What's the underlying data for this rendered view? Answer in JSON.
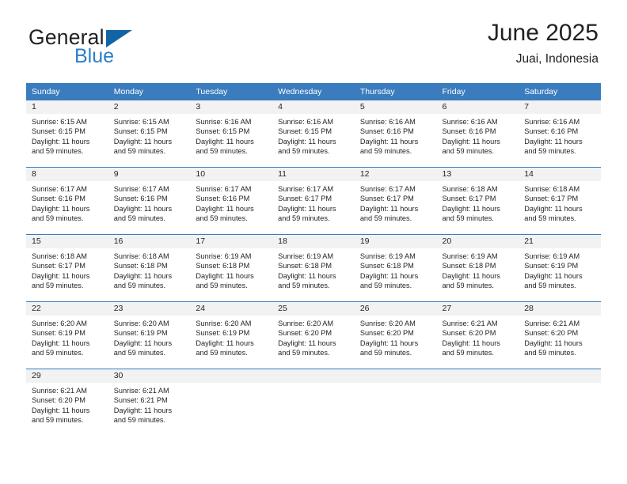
{
  "logo": {
    "word1": "General",
    "word2": "Blue",
    "triangle_color": "#1464a5",
    "blue_color": "#2a7fc9"
  },
  "header": {
    "title": "June 2025",
    "subtitle": "Juai, Indonesia"
  },
  "theme": {
    "header_blue": "#3a7cbe",
    "daynum_bg": "#f2f2f2",
    "text": "#231f20"
  },
  "weekdays": [
    "Sunday",
    "Monday",
    "Tuesday",
    "Wednesday",
    "Thursday",
    "Friday",
    "Saturday"
  ],
  "labels": {
    "sunrise_prefix": "Sunrise: ",
    "sunset_prefix": "Sunset: ",
    "daylight_prefix": "Daylight: "
  },
  "weeks": [
    [
      {
        "day": "1",
        "sunrise": "Sunrise: 6:15 AM",
        "sunset": "Sunset: 6:15 PM",
        "daylight1": "Daylight: 11 hours",
        "daylight2": "and 59 minutes."
      },
      {
        "day": "2",
        "sunrise": "Sunrise: 6:15 AM",
        "sunset": "Sunset: 6:15 PM",
        "daylight1": "Daylight: 11 hours",
        "daylight2": "and 59 minutes."
      },
      {
        "day": "3",
        "sunrise": "Sunrise: 6:16 AM",
        "sunset": "Sunset: 6:15 PM",
        "daylight1": "Daylight: 11 hours",
        "daylight2": "and 59 minutes."
      },
      {
        "day": "4",
        "sunrise": "Sunrise: 6:16 AM",
        "sunset": "Sunset: 6:15 PM",
        "daylight1": "Daylight: 11 hours",
        "daylight2": "and 59 minutes."
      },
      {
        "day": "5",
        "sunrise": "Sunrise: 6:16 AM",
        "sunset": "Sunset: 6:16 PM",
        "daylight1": "Daylight: 11 hours",
        "daylight2": "and 59 minutes."
      },
      {
        "day": "6",
        "sunrise": "Sunrise: 6:16 AM",
        "sunset": "Sunset: 6:16 PM",
        "daylight1": "Daylight: 11 hours",
        "daylight2": "and 59 minutes."
      },
      {
        "day": "7",
        "sunrise": "Sunrise: 6:16 AM",
        "sunset": "Sunset: 6:16 PM",
        "daylight1": "Daylight: 11 hours",
        "daylight2": "and 59 minutes."
      }
    ],
    [
      {
        "day": "8",
        "sunrise": "Sunrise: 6:17 AM",
        "sunset": "Sunset: 6:16 PM",
        "daylight1": "Daylight: 11 hours",
        "daylight2": "and 59 minutes."
      },
      {
        "day": "9",
        "sunrise": "Sunrise: 6:17 AM",
        "sunset": "Sunset: 6:16 PM",
        "daylight1": "Daylight: 11 hours",
        "daylight2": "and 59 minutes."
      },
      {
        "day": "10",
        "sunrise": "Sunrise: 6:17 AM",
        "sunset": "Sunset: 6:16 PM",
        "daylight1": "Daylight: 11 hours",
        "daylight2": "and 59 minutes."
      },
      {
        "day": "11",
        "sunrise": "Sunrise: 6:17 AM",
        "sunset": "Sunset: 6:17 PM",
        "daylight1": "Daylight: 11 hours",
        "daylight2": "and 59 minutes."
      },
      {
        "day": "12",
        "sunrise": "Sunrise: 6:17 AM",
        "sunset": "Sunset: 6:17 PM",
        "daylight1": "Daylight: 11 hours",
        "daylight2": "and 59 minutes."
      },
      {
        "day": "13",
        "sunrise": "Sunrise: 6:18 AM",
        "sunset": "Sunset: 6:17 PM",
        "daylight1": "Daylight: 11 hours",
        "daylight2": "and 59 minutes."
      },
      {
        "day": "14",
        "sunrise": "Sunrise: 6:18 AM",
        "sunset": "Sunset: 6:17 PM",
        "daylight1": "Daylight: 11 hours",
        "daylight2": "and 59 minutes."
      }
    ],
    [
      {
        "day": "15",
        "sunrise": "Sunrise: 6:18 AM",
        "sunset": "Sunset: 6:17 PM",
        "daylight1": "Daylight: 11 hours",
        "daylight2": "and 59 minutes."
      },
      {
        "day": "16",
        "sunrise": "Sunrise: 6:18 AM",
        "sunset": "Sunset: 6:18 PM",
        "daylight1": "Daylight: 11 hours",
        "daylight2": "and 59 minutes."
      },
      {
        "day": "17",
        "sunrise": "Sunrise: 6:19 AM",
        "sunset": "Sunset: 6:18 PM",
        "daylight1": "Daylight: 11 hours",
        "daylight2": "and 59 minutes."
      },
      {
        "day": "18",
        "sunrise": "Sunrise: 6:19 AM",
        "sunset": "Sunset: 6:18 PM",
        "daylight1": "Daylight: 11 hours",
        "daylight2": "and 59 minutes."
      },
      {
        "day": "19",
        "sunrise": "Sunrise: 6:19 AM",
        "sunset": "Sunset: 6:18 PM",
        "daylight1": "Daylight: 11 hours",
        "daylight2": "and 59 minutes."
      },
      {
        "day": "20",
        "sunrise": "Sunrise: 6:19 AM",
        "sunset": "Sunset: 6:18 PM",
        "daylight1": "Daylight: 11 hours",
        "daylight2": "and 59 minutes."
      },
      {
        "day": "21",
        "sunrise": "Sunrise: 6:19 AM",
        "sunset": "Sunset: 6:19 PM",
        "daylight1": "Daylight: 11 hours",
        "daylight2": "and 59 minutes."
      }
    ],
    [
      {
        "day": "22",
        "sunrise": "Sunrise: 6:20 AM",
        "sunset": "Sunset: 6:19 PM",
        "daylight1": "Daylight: 11 hours",
        "daylight2": "and 59 minutes."
      },
      {
        "day": "23",
        "sunrise": "Sunrise: 6:20 AM",
        "sunset": "Sunset: 6:19 PM",
        "daylight1": "Daylight: 11 hours",
        "daylight2": "and 59 minutes."
      },
      {
        "day": "24",
        "sunrise": "Sunrise: 6:20 AM",
        "sunset": "Sunset: 6:19 PM",
        "daylight1": "Daylight: 11 hours",
        "daylight2": "and 59 minutes."
      },
      {
        "day": "25",
        "sunrise": "Sunrise: 6:20 AM",
        "sunset": "Sunset: 6:20 PM",
        "daylight1": "Daylight: 11 hours",
        "daylight2": "and 59 minutes."
      },
      {
        "day": "26",
        "sunrise": "Sunrise: 6:20 AM",
        "sunset": "Sunset: 6:20 PM",
        "daylight1": "Daylight: 11 hours",
        "daylight2": "and 59 minutes."
      },
      {
        "day": "27",
        "sunrise": "Sunrise: 6:21 AM",
        "sunset": "Sunset: 6:20 PM",
        "daylight1": "Daylight: 11 hours",
        "daylight2": "and 59 minutes."
      },
      {
        "day": "28",
        "sunrise": "Sunrise: 6:21 AM",
        "sunset": "Sunset: 6:20 PM",
        "daylight1": "Daylight: 11 hours",
        "daylight2": "and 59 minutes."
      }
    ],
    [
      {
        "day": "29",
        "sunrise": "Sunrise: 6:21 AM",
        "sunset": "Sunset: 6:20 PM",
        "daylight1": "Daylight: 11 hours",
        "daylight2": "and 59 minutes."
      },
      {
        "day": "30",
        "sunrise": "Sunrise: 6:21 AM",
        "sunset": "Sunset: 6:21 PM",
        "daylight1": "Daylight: 11 hours",
        "daylight2": "and 59 minutes."
      },
      {
        "day": "",
        "sunrise": "",
        "sunset": "",
        "daylight1": "",
        "daylight2": ""
      },
      {
        "day": "",
        "sunrise": "",
        "sunset": "",
        "daylight1": "",
        "daylight2": ""
      },
      {
        "day": "",
        "sunrise": "",
        "sunset": "",
        "daylight1": "",
        "daylight2": ""
      },
      {
        "day": "",
        "sunrise": "",
        "sunset": "",
        "daylight1": "",
        "daylight2": ""
      },
      {
        "day": "",
        "sunrise": "",
        "sunset": "",
        "daylight1": "",
        "daylight2": ""
      }
    ]
  ]
}
